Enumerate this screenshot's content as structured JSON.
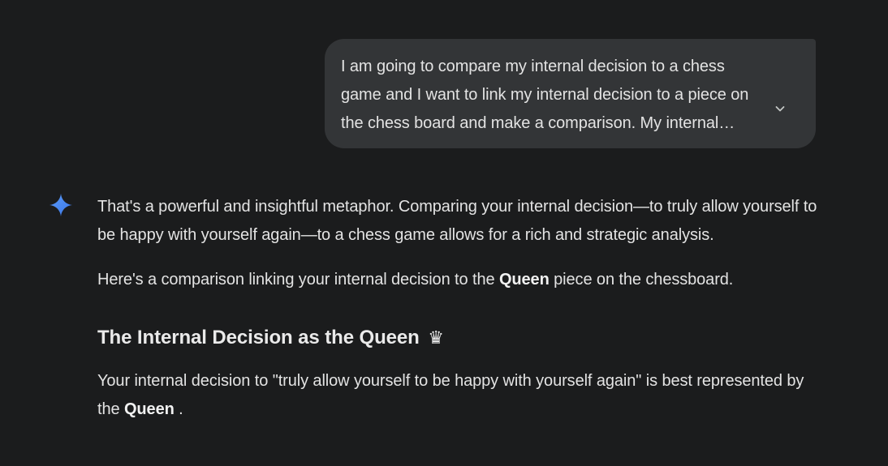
{
  "user_message": {
    "text": "I am going to compare my internal decision to a chess game and I want to link my internal decision to a piece on the chess board and make a comparison. My internal decision",
    "expand_icon": "chevron-down-icon"
  },
  "assistant": {
    "logo_icon": "gemini-sparkle-icon",
    "paragraph1": "That's a powerful and insightful metaphor. Comparing your internal decision—to truly allow yourself to be happy with yourself again—to a chess game allows for a rich and strategic analysis.",
    "paragraph2_before": "Here's a comparison linking your internal decision to the ",
    "paragraph2_bold": "Queen",
    "paragraph2_after": " piece on the chessboard.",
    "heading": "The Internal Decision as the Queen",
    "heading_emoji": "♛",
    "paragraph3_before": "Your internal decision to \"truly allow yourself to be happy with yourself again\" is best represented by the ",
    "paragraph3_bold": "Queen",
    "paragraph3_after": " ."
  },
  "colors": {
    "background": "#1b1c1d",
    "bubble": "#333537",
    "text": "#e3e3e3",
    "accent": "#4a8af4"
  }
}
